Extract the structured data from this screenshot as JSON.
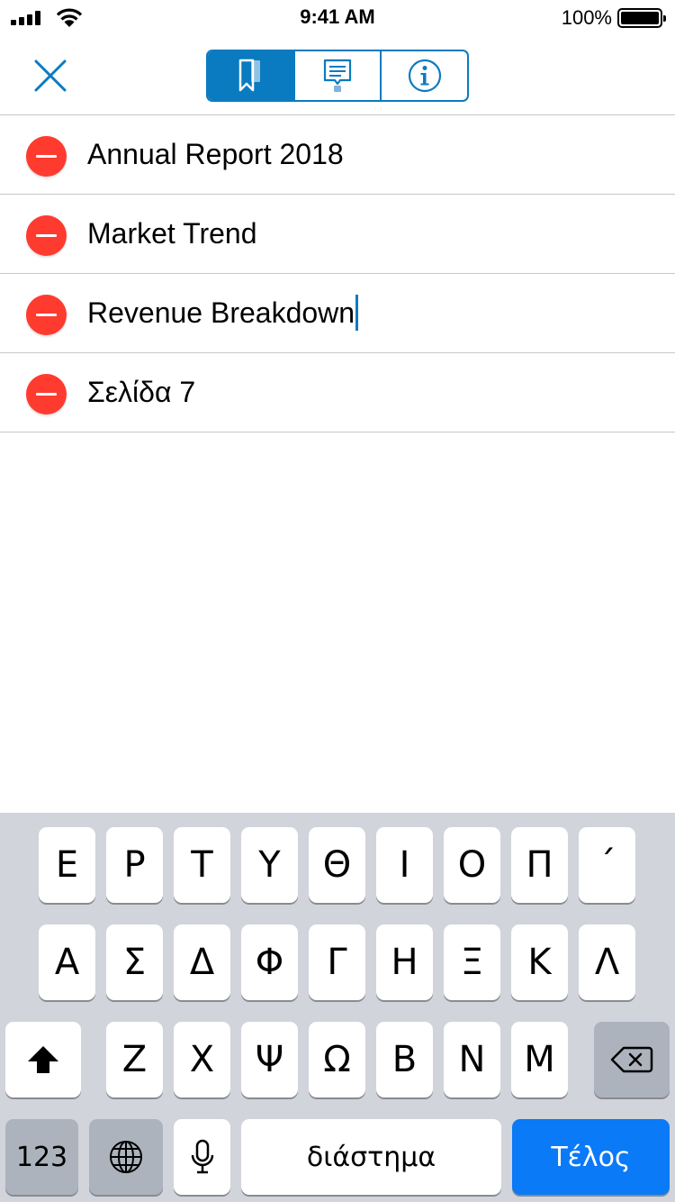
{
  "status_bar": {
    "time": "9:41 AM",
    "battery_percent": "100%",
    "signal_icon": "cellular-signal-icon",
    "wifi_icon": "wifi-icon",
    "battery_icon": "battery-icon"
  },
  "nav": {
    "close_icon": "close-icon",
    "segments": [
      {
        "icon": "bookmark-icon",
        "selected": true
      },
      {
        "icon": "annotation-icon",
        "selected": false
      },
      {
        "icon": "info-icon",
        "selected": false
      }
    ],
    "accent_color": "#0a7bc0"
  },
  "bookmarks": [
    {
      "label": "Annual Report 2018"
    },
    {
      "label": "Market Trend"
    },
    {
      "label": "Revenue Breakdown",
      "editing": true
    },
    {
      "label": "Σελίδα 7"
    }
  ],
  "keyboard": {
    "row1": [
      "Ε",
      "Ρ",
      "Τ",
      "Υ",
      "Θ",
      "Ι",
      "Ο",
      "Π",
      "´"
    ],
    "row2": [
      "Α",
      "Σ",
      "Δ",
      "Φ",
      "Γ",
      "Η",
      "Ξ",
      "Κ",
      "Λ"
    ],
    "row3": [
      "Ζ",
      "Χ",
      "Ψ",
      "Ω",
      "Β",
      "Ν",
      "Μ"
    ],
    "numbers_label": "123",
    "space_label": "διάστημα",
    "done_label": "Τέλος",
    "shift_icon": "shift-icon",
    "delete_icon": "backspace-icon",
    "globe_icon": "globe-icon",
    "mic_icon": "microphone-icon",
    "done_color": "#0a7af6",
    "delete_button_color": "#ff3b30"
  }
}
